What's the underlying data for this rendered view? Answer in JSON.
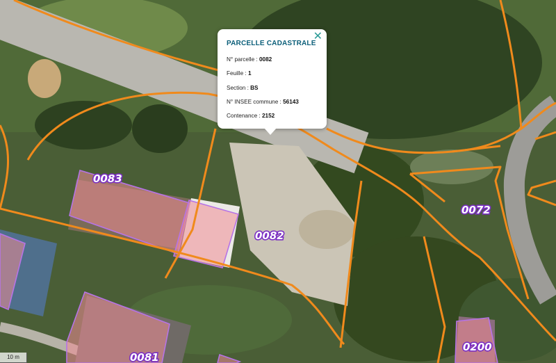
{
  "popup": {
    "title": "PARCELLE CADASTRALE",
    "close_glyph": "✕",
    "fields": [
      {
        "label": "N° parcelle : ",
        "value": "0082"
      },
      {
        "label": "Feuille : ",
        "value": "1"
      },
      {
        "label": "Section : ",
        "value": "BS"
      },
      {
        "label": "N° INSEE commune : ",
        "value": "56143"
      },
      {
        "label": "Contenance : ",
        "value": "2152"
      }
    ]
  },
  "parcel_labels": {
    "p0083": "0083",
    "p0082": "0082",
    "p0072": "0072",
    "p0081": "0081",
    "p0200": "0200"
  },
  "scale": {
    "label": "10 m"
  },
  "colors": {
    "parcel_border": "#f08a1c",
    "building_outline": "#b673e6",
    "popup_title": "#0c5f7a",
    "close_icon": "#2a9a96"
  }
}
